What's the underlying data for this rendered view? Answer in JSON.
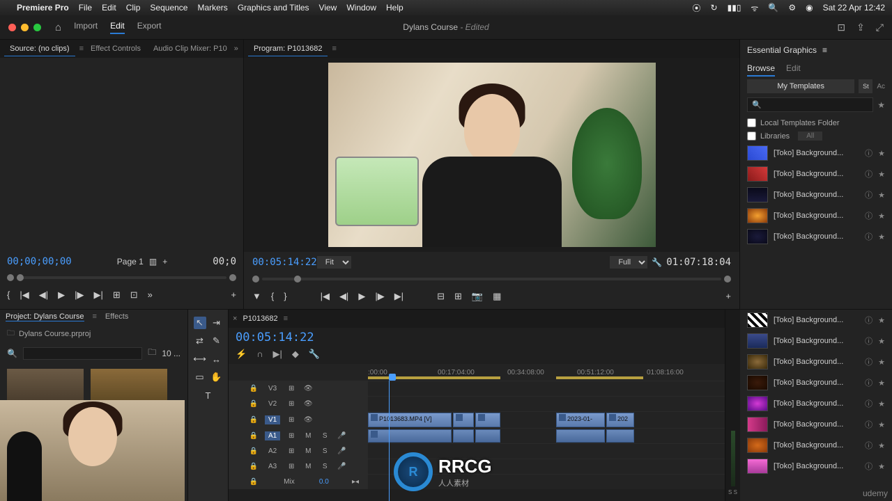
{
  "macos": {
    "app_name": "Premiere Pro",
    "menus": [
      "File",
      "Edit",
      "Clip",
      "Sequence",
      "Markers",
      "Graphics and Titles",
      "View",
      "Window",
      "Help"
    ],
    "clock": "Sat 22 Apr 12:42"
  },
  "titlebar": {
    "workspaces": [
      "Import",
      "Edit",
      "Export"
    ],
    "active_workspace": "Edit",
    "doc_title": "Dylans Course",
    "edited_suffix": "- Edited"
  },
  "source": {
    "tabs": [
      "Source: (no clips)",
      "Effect Controls",
      "Audio Clip Mixer: P10"
    ],
    "active_tab": "Source: (no clips)",
    "timecode": "00;00;00;00",
    "page": "Page 1",
    "right_tc": "00;0"
  },
  "program": {
    "tab": "Program: P1013682",
    "timecode": "00:05:14:22",
    "zoom": "Fit",
    "quality": "Full",
    "duration": "01:07:18:04"
  },
  "essential_graphics": {
    "title": "Essential Graphics",
    "tabs": [
      "Browse",
      "Edit"
    ],
    "active_tab": "Browse",
    "my_templates": "My Templates",
    "stock_abbrev": "St",
    "ac_abbrev": "Ac",
    "local_folder_label": "Local Templates Folder",
    "libraries_label": "Libraries",
    "libraries_filter": "All",
    "items": [
      {
        "label": "[Toko] Background...",
        "bg": "linear-gradient(45deg,#2a4ad4,#4a6af4)"
      },
      {
        "label": "[Toko] Background...",
        "bg": "linear-gradient(45deg,#8a1a1a,#d43a3a)"
      },
      {
        "label": "[Toko] Background...",
        "bg": "linear-gradient(#0a0a1a,#1a1a3a)"
      },
      {
        "label": "[Toko] Background...",
        "bg": "radial-gradient(#f4a030,#8a3a0a)"
      },
      {
        "label": "[Toko] Background...",
        "bg": "radial-gradient(#1a1a3a,#0a0a1a)"
      },
      {
        "label": "[Toko] Background...",
        "bg": "repeating-linear-gradient(45deg,#000 0 4px,#fff 4px 8px)"
      },
      {
        "label": "[Toko] Background...",
        "bg": "linear-gradient(#3a4a8a,#1a2a5a)"
      },
      {
        "label": "[Toko] Background...",
        "bg": "radial-gradient(#8a6a3a,#3a2a0a)"
      },
      {
        "label": "[Toko] Background...",
        "bg": "radial-gradient(#3a1a0a,#1a0a00)"
      },
      {
        "label": "[Toko] Background...",
        "bg": "radial-gradient(#d43ad4,#5a0a8a)"
      },
      {
        "label": "[Toko] Background...",
        "bg": "linear-gradient(90deg,#d43a8a,#8a1a5a)"
      },
      {
        "label": "[Toko] Background...",
        "bg": "radial-gradient(#d46a1a,#8a3a0a)"
      },
      {
        "label": "[Toko] Background...",
        "bg": "linear-gradient(#f46ad4,#a83a9a)"
      }
    ]
  },
  "project": {
    "tab_project": "Project: Dylans Course",
    "tab_effects": "Effects",
    "file_row": "Dylans Course.prproj",
    "item_count": "10 ..."
  },
  "timeline": {
    "seq_name": "P1013682",
    "timecode": "00:05:14:22",
    "ruler": [
      ":00:00",
      "00:17:04:00",
      "00:34:08:00",
      "00:51:12:00",
      "01:08:16:00"
    ],
    "tracks": {
      "v3": "V3",
      "v2": "V2",
      "v1": "V1",
      "a1": "A1",
      "a2": "A2",
      "a3": "A3",
      "mix": "Mix"
    },
    "mix_db": "0.0",
    "clip_v1_main": "P1013683.MP4 [V]",
    "clip_v1_b": "2023-01-",
    "clip_v1_c": "202",
    "audio_meter_label": "S S"
  },
  "watermark": {
    "text": "RRCG",
    "cn": "人人素材",
    "udemy": "udemy"
  }
}
